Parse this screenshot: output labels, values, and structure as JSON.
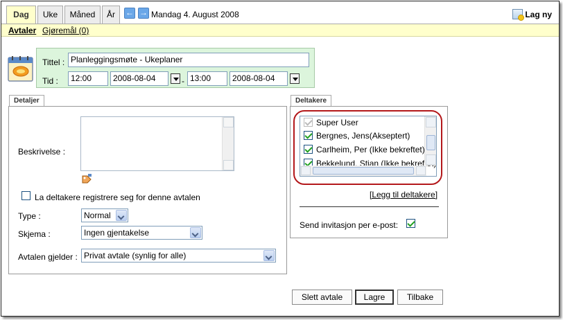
{
  "view_tabs": [
    "Dag",
    "Uke",
    "Måned",
    "År"
  ],
  "current_date": "Mandag 4. August 2008",
  "new_button": "Lag ny",
  "subtabs": {
    "appointments": "Avtaler",
    "tasks": "Gjøremål (0)"
  },
  "header": {
    "title_label": "Tittel :",
    "title_value": "Planleggingsmøte - Ukeplaner",
    "time_label": "Tid :",
    "start_time": "12:00",
    "start_date": "2008-08-04",
    "separator": "-",
    "end_time": "13:00",
    "end_date": "2008-08-04"
  },
  "details": {
    "tab": "Detaljer",
    "description_label": "Beskrivelse :",
    "self_register_label": "La deltakere registrere seg for denne avtalen",
    "type_label": "Type :",
    "type_value": "Normal",
    "schema_label": "Skjema :",
    "schema_value": "Ingen gjentakelse",
    "applies_label": "Avtalen gjelder :",
    "applies_value": "Privat avtale (synlig for alle)"
  },
  "participants": {
    "tab": "Deltakere",
    "items": [
      {
        "name": "Super User",
        "checked": true,
        "disabled": true
      },
      {
        "name": "Bergnes, Jens(Akseptert)",
        "checked": true,
        "disabled": false
      },
      {
        "name": "Carlheim, Per (Ikke bekreftet)",
        "checked": true,
        "disabled": false
      },
      {
        "name": "Bekkelund, Stian (Ikke bekreftet)",
        "checked": true,
        "disabled": false
      }
    ],
    "add_link": "[Legg til deltakere]",
    "send_invite_label": "Send invitasjon per e-post:"
  },
  "buttons": {
    "delete": "Slett avtale",
    "save": "Lagre",
    "back": "Tilbake"
  },
  "colors": {
    "tab_active_bg": "#ffffcc",
    "header_bg": "#dcf5dc",
    "highlight": "#b3171a",
    "check": "#21a121"
  }
}
